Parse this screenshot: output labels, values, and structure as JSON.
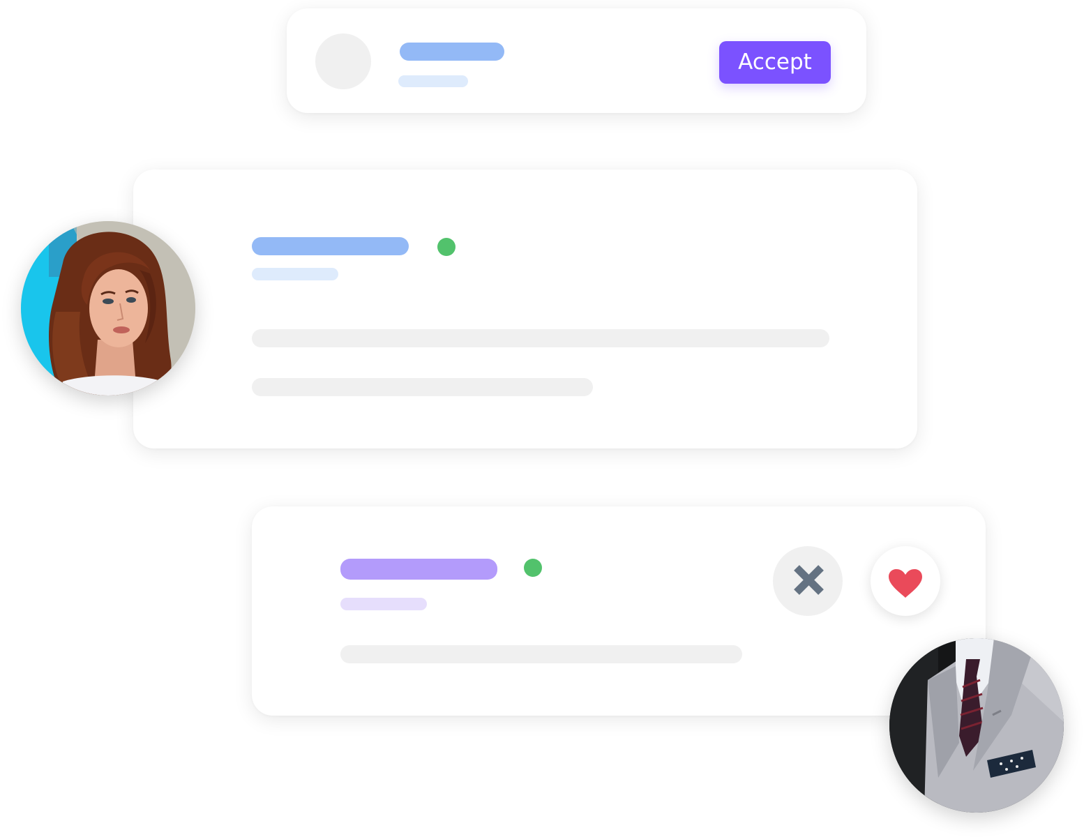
{
  "colors": {
    "card_bg": "#ffffff",
    "placeholder_gray": "#f0f0f0",
    "blue_bar": "#93b9f6",
    "light_blue_bar": "#deebfc",
    "purple_bar": "#b39bfb",
    "light_purple_bar": "#e6defc",
    "online_green": "#52c26c",
    "accept_purple": "#7b52ff",
    "close_icon_gray": "#647282",
    "heart_red": "#ea4a5a"
  },
  "request_card": {
    "accept_label": "Accept"
  },
  "profile_card": {
    "status": "online",
    "photo_icon": "woman-portrait-photo"
  },
  "match_card": {
    "status": "online",
    "reject_icon": "close-icon",
    "like_icon": "heart-icon",
    "photo_icon": "man-suit-photo"
  }
}
